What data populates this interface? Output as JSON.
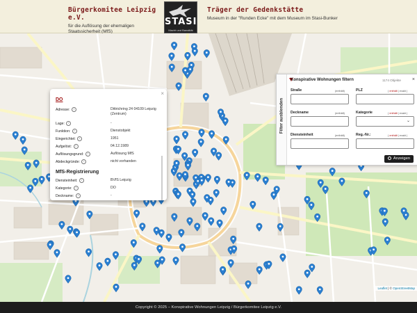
{
  "header": {
    "left_title": "Bürgerkomitee Leipzig e.V.",
    "left_sub": "für die Auflösung der ehemaligen Staatssicherheit (MfS)",
    "logo_text": "STASI",
    "logo_small": "Macht und Banalität",
    "right_title": "Träger der Gedenkstätte",
    "right_sub": "Museum in der \"Runden Ecke\" mit dem Museum im Stasi-Bunker"
  },
  "popup": {
    "title": "DO",
    "close": "×",
    "rows": [
      {
        "key": "Adresse:",
        "value": "Dittrichring 24 04109 Leipzig (Zentrum)"
      },
      {
        "key": "Lage:",
        "value": "-"
      },
      {
        "key": "Funktion:",
        "value": "Dienstobjekt"
      },
      {
        "key": "Eingerichtet:",
        "value": "1951"
      },
      {
        "key": "Aufgelöst:",
        "value": "04.12.1989"
      },
      {
        "key": "Auflösungsgrund:",
        "value": "Auflösung MfS"
      },
      {
        "key": "Abdeckgründe:",
        "value": "nicht vorhanden"
      }
    ],
    "section_title": "MfS-Registrierung",
    "reg_rows": [
      {
        "key": "Diensteinheit:",
        "value": "BVfS Leipzig"
      },
      {
        "key": "Kategorie:",
        "value": "DO"
      },
      {
        "key": "Deckname:",
        "value": "-"
      }
    ]
  },
  "filter": {
    "side_tab": "Filter ausblenden",
    "title": "Konspirative Wohnungen filtern",
    "count": "1174 Objekte",
    "close": "×",
    "fields": [
      {
        "label": "Straße",
        "hint": "(enthält)",
        "type": "input"
      },
      {
        "label": "PLZ",
        "hint_a": "( ",
        "hint_b": "enthält",
        "hint_c": " | exakt )",
        "type": "input"
      },
      {
        "label": "Deckname",
        "hint": "(enthält)",
        "type": "input"
      },
      {
        "label": "Kategorie",
        "hint_a": "( ",
        "hint_b": "enthält",
        "hint_c": " | exakt )",
        "type": "select"
      },
      {
        "label": "Diensteinheit",
        "hint": "(enthält)",
        "type": "input"
      },
      {
        "label": "Reg.-Nr.:",
        "hint_a": "( ",
        "hint_b": "enthält",
        "hint_c": " | exakt )",
        "type": "input"
      }
    ],
    "select_arrow": "⌄",
    "submit_label": "Anzeigen"
  },
  "map": {
    "attribution_a": "Leaflet",
    "attribution_b": " | © ",
    "attribution_c": "OpenStreetMap"
  },
  "footer": {
    "text": "Copyright © 2025 – Konspirative Wohnungen Leipzig / Bürgerkomitee Leipzig e.V."
  },
  "colors": {
    "accent": "#7a1818",
    "pin": "#2a7fd1",
    "footer_bg": "#1d1d1d"
  }
}
